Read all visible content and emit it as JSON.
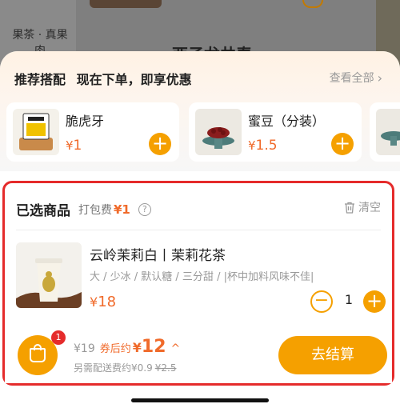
{
  "background": {
    "category_label": "果茶 · 真果肉",
    "product_title": "西子龙井春"
  },
  "recommend": {
    "title": "推荐搭配",
    "subtitle": "现在下单，即享优惠",
    "view_all": "查看全部",
    "items": [
      {
        "name": "脆虎牙",
        "currency": "¥",
        "price": "1"
      },
      {
        "name": "蜜豆（分装）",
        "currency": "¥",
        "price": "1.5"
      }
    ]
  },
  "selected": {
    "title": "已选商品",
    "pack_fee_label": "打包费",
    "pack_fee": "¥1",
    "help_icon": "?",
    "clear_label": "清空",
    "item": {
      "name": "云岭茉莉白丨茉莉花茶",
      "spec": "大 / 少冰 / 默认糖 / 三分甜 / |杯中加料风味不佳|",
      "currency": "¥",
      "price": "18",
      "quantity": "1"
    }
  },
  "checkout": {
    "cart_count": "1",
    "original_price": "¥19",
    "coupon_label": "券后约",
    "final_currency": "¥",
    "final_price": "12",
    "delivery_label": "另需配送费约¥0.9",
    "delivery_original": "¥2.5",
    "button_label": "去结算"
  },
  "colors": {
    "accent": "#f5a000",
    "price": "#f06a2a",
    "highlight_border": "#e52b2b"
  }
}
